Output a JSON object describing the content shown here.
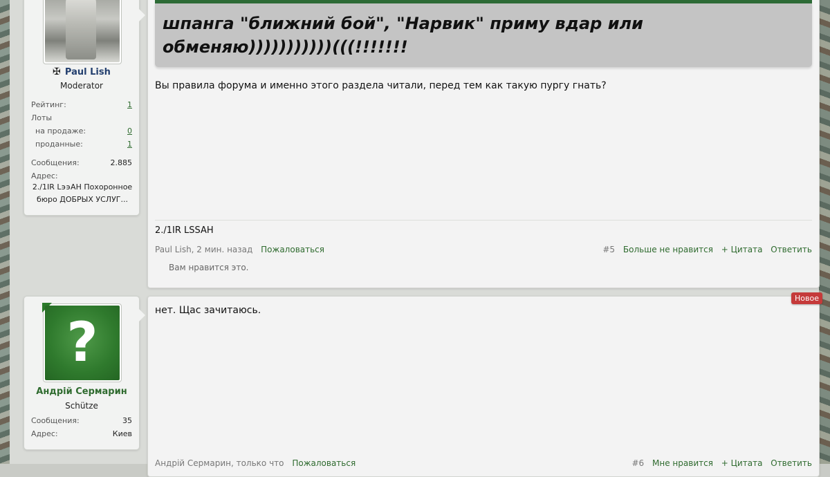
{
  "posts": [
    {
      "user": {
        "name": "Paul Lish",
        "title": "Moderator",
        "rating_label": "Рейтинг:",
        "rating": "1",
        "lots_label": "Лоты",
        "on_sale_label": "на продаже:",
        "on_sale": "0",
        "sold_label": "проданные:",
        "sold": "1",
        "messages_label": "Сообщения:",
        "messages": "2.885",
        "address_label": "Адрес:",
        "address": "2./1IR L϶϶AH Похоронное бюро ДОБРЫХ УСЛУГ..."
      },
      "quote_text": "шпанга \"ближний бой\", \"Нарвик\" приму вдар или обменяю)))))))))))(((!!!!!!!",
      "body": "Вы правила форума и именно этого раздела читали, перед тем как такую пургу гнать?",
      "signature": "2./1IR LSSAH",
      "meta": {
        "author": "Paul Lish, 2 мин. назад",
        "report": "Пожаловаться",
        "number": "#5",
        "like": "Больше не нравится",
        "quote": "+ Цитата",
        "reply": "Ответить"
      },
      "likes_text": "Вам нравится это."
    },
    {
      "user": {
        "name": "Андрій Сермарин",
        "title": "Schütze",
        "messages_label": "Сообщения:",
        "messages": "35",
        "address_label": "Адрес:",
        "address": "Киев"
      },
      "badge": "Новое",
      "body": "нет. Щас зачитаюсь.",
      "meta": {
        "author": "Андрій Сермарин, только что",
        "report": "Пожаловаться",
        "number": "#6",
        "like": "Мне нравится",
        "quote": "+ Цитата",
        "reply": "Ответить"
      }
    }
  ]
}
